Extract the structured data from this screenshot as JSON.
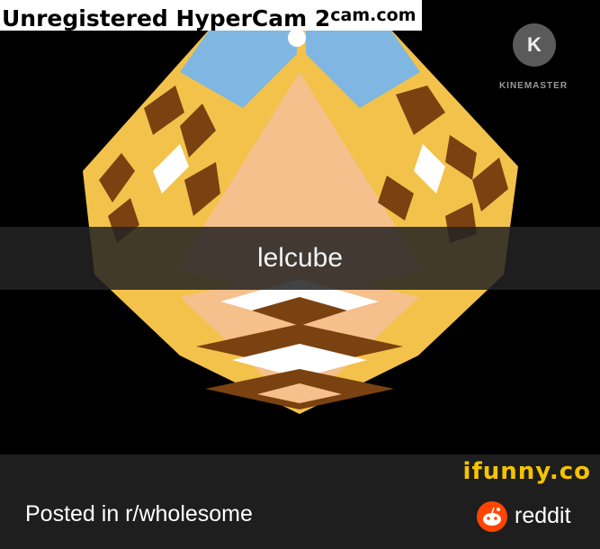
{
  "watermark": {
    "main": "Unregistered HyperCam 2",
    "suffix": "cam.com"
  },
  "kinemaster": {
    "logo_letter": "K",
    "label": "KINEMASTER"
  },
  "caption": "lelcube",
  "footer": {
    "ifunny": "ifunny.co",
    "posted": "Posted in r/wholesome",
    "source": "reddit"
  },
  "colors": {
    "cube_yellow": "#f3c24b",
    "cube_peach": "#f6c08c",
    "cube_blue": "#7fb6e2",
    "cube_brown": "#7a4210",
    "ifunny_yellow": "#f5c400",
    "reddit_orange": "#ff4500"
  }
}
